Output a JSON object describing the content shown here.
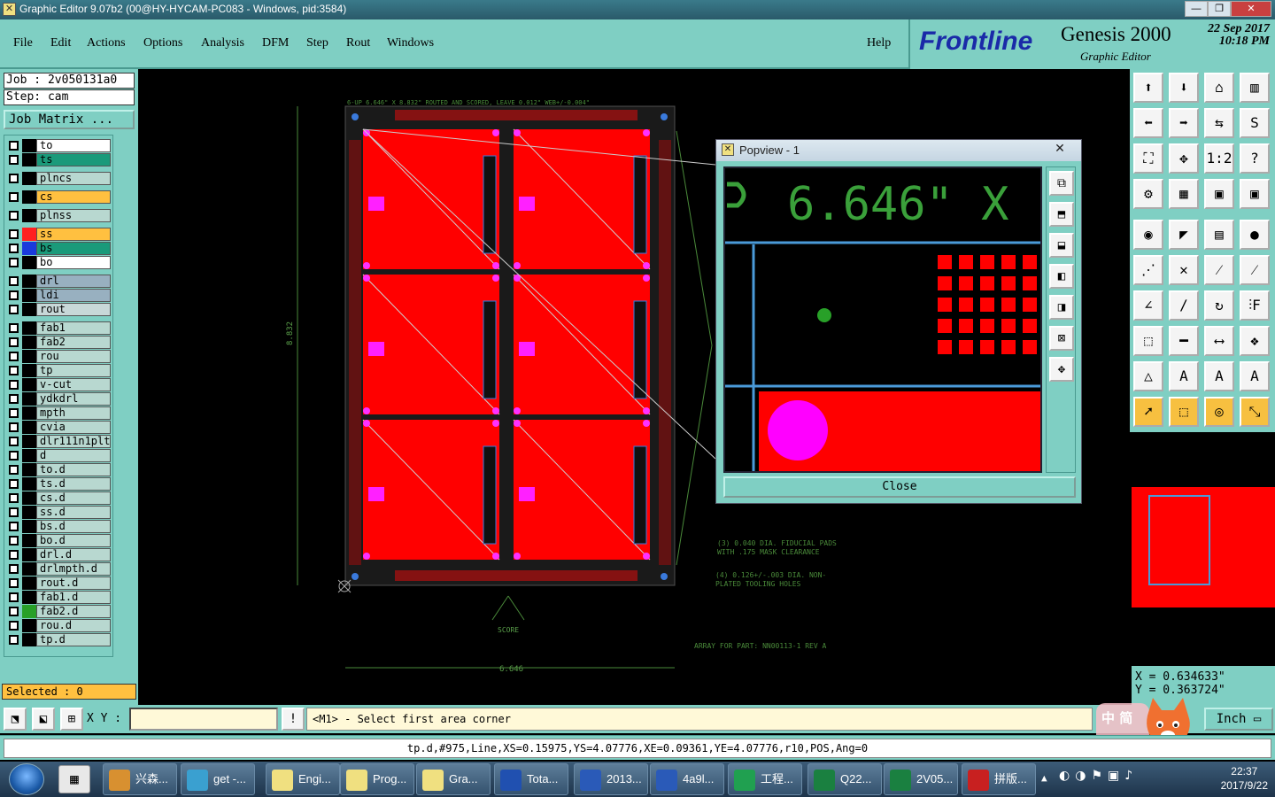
{
  "window": {
    "title": "Graphic Editor 9.07b2 (00@HY-HYCAM-PC083 - Windows, pid:3584)",
    "min_label": "—",
    "max_label": "❐",
    "close_label": "✕"
  },
  "menu": {
    "items": [
      "File",
      "Edit",
      "Actions",
      "Options",
      "Analysis",
      "DFM",
      "Step",
      "Rout",
      "Windows"
    ],
    "help": "Help"
  },
  "brand": {
    "logo": "Frontline",
    "product": "Genesis 2000",
    "subtitle": "Graphic Editor",
    "date": "22 Sep 2017",
    "time": "10:18 PM"
  },
  "job": {
    "job_line": "Job : 2v050131a0",
    "step_line": "Step: cam",
    "matrix_button": "Job Matrix ..."
  },
  "layers": [
    {
      "name": "to",
      "bg": "#ffffff",
      "swatch": "#000000",
      "gap": false
    },
    {
      "name": "ts",
      "bg": "#1a9a7a",
      "swatch": "#000000",
      "gap": false
    },
    {
      "name": "plncs",
      "bg": "#b8d8d0",
      "swatch": "#000000",
      "gap": true
    },
    {
      "name": "cs",
      "bg": "#ffc040",
      "swatch": "#000000",
      "gap": true
    },
    {
      "name": "plnss",
      "bg": "#b8d8d0",
      "swatch": "#000000",
      "gap": true
    },
    {
      "name": "ss",
      "bg": "#ffc040",
      "swatch": "#ff2020",
      "gap": true
    },
    {
      "name": "bs",
      "bg": "#1a9a7a",
      "swatch": "#1a3adc",
      "gap": false
    },
    {
      "name": "bo",
      "bg": "#ffffff",
      "swatch": "#000000",
      "gap": false
    },
    {
      "name": "drl",
      "bg": "#98b0c0",
      "swatch": "#000000",
      "gap": true
    },
    {
      "name": "ldi",
      "bg": "#98b0c0",
      "swatch": "#000000",
      "gap": false
    },
    {
      "name": "rout",
      "bg": "#c8d8d8",
      "swatch": "#000000",
      "gap": false
    },
    {
      "name": "fab1",
      "bg": "#b8d8d0",
      "swatch": "#000000",
      "gap": true
    },
    {
      "name": "fab2",
      "bg": "#b8d8d0",
      "swatch": "#000000",
      "gap": false
    },
    {
      "name": "rou",
      "bg": "#b8d8d0",
      "swatch": "#000000",
      "gap": false
    },
    {
      "name": "tp",
      "bg": "#b8d8d0",
      "swatch": "#000000",
      "gap": false
    },
    {
      "name": "v-cut",
      "bg": "#b8d8d0",
      "swatch": "#000000",
      "gap": false
    },
    {
      "name": "ydkdrl",
      "bg": "#b8d8d0",
      "swatch": "#000000",
      "gap": false
    },
    {
      "name": "mpth",
      "bg": "#b8d8d0",
      "swatch": "#000000",
      "gap": false
    },
    {
      "name": "cvia",
      "bg": "#b8d8d0",
      "swatch": "#000000",
      "gap": false
    },
    {
      "name": "dlr111n1plt",
      "bg": "#b8d8d0",
      "swatch": "#000000",
      "gap": false
    },
    {
      "name": "d",
      "bg": "#b8d8d0",
      "swatch": "#000000",
      "gap": false
    },
    {
      "name": "to.d",
      "bg": "#b8d8d0",
      "swatch": "#000000",
      "gap": false
    },
    {
      "name": "ts.d",
      "bg": "#b8d8d0",
      "swatch": "#000000",
      "gap": false
    },
    {
      "name": "cs.d",
      "bg": "#b8d8d0",
      "swatch": "#000000",
      "gap": false
    },
    {
      "name": "ss.d",
      "bg": "#b8d8d0",
      "swatch": "#000000",
      "gap": false
    },
    {
      "name": "bs.d",
      "bg": "#b8d8d0",
      "swatch": "#000000",
      "gap": false
    },
    {
      "name": "bo.d",
      "bg": "#b8d8d0",
      "swatch": "#000000",
      "gap": false
    },
    {
      "name": "drl.d",
      "bg": "#b8d8d0",
      "swatch": "#000000",
      "gap": false
    },
    {
      "name": "drlmpth.d",
      "bg": "#b8d8d0",
      "swatch": "#000000",
      "gap": false
    },
    {
      "name": "rout.d",
      "bg": "#b8d8d0",
      "swatch": "#000000",
      "gap": false
    },
    {
      "name": "fab1.d",
      "bg": "#b8d8d0",
      "swatch": "#000000",
      "gap": false
    },
    {
      "name": "fab2.d",
      "bg": "#b8d8d0",
      "swatch": "#28a028",
      "gap": false
    },
    {
      "name": "rou.d",
      "bg": "#b8d8d0",
      "swatch": "#000000",
      "gap": false
    },
    {
      "name": "tp.d",
      "bg": "#b8d8d0",
      "swatch": "#000000",
      "gap": false
    }
  ],
  "selected": "Selected : 0",
  "board": {
    "header_note": "6-UP 6.646\" X 8.832\" ROUTED AND SCORED, LEAVE 0.012\" WEB+/-0.004\"",
    "fiducial_note_1": "(3) 0.040 DIA. FIDUCIAL PADS",
    "fiducial_note_2": "WITH .175 MASK CLEARANCE",
    "tooling_note_1": "(4) 0.126+/-.003 DIA. NON-",
    "tooling_note_2": "PLATED TOOLING HOLES",
    "array_note": "ARRAY FOR PART: NN00113-1 REV A",
    "score_label": "SCORE",
    "width_dim": "6.646",
    "height_dim": "8.832"
  },
  "popview": {
    "title": "Popview - 1",
    "zoom_text": "6.646\" X",
    "close_button": "Close"
  },
  "coords": {
    "x_line": "X = 0.634633\"",
    "y_line": "Y = 0.363724\""
  },
  "command": {
    "xy_label": "X Y :",
    "xy_value": "",
    "prompt": "<M1> - Select first area corner",
    "unit": "Inch",
    "status": "tp.d,#975,Line,XS=0.15975,YS=4.07776,XE=0.09361,YE=4.07776,r10,POS,Ang=0"
  },
  "taskbar": {
    "items": [
      {
        "label": "兴森...",
        "icon": "#d89030"
      },
      {
        "label": "get -...",
        "icon": "#3aa0d0"
      },
      {
        "label": "Engi...",
        "icon": "#f0e080"
      },
      {
        "label": "Prog...",
        "icon": "#f0e080"
      },
      {
        "label": "Gra...",
        "icon": "#f0e080"
      },
      {
        "label": "Tota...",
        "icon": "#2050b0"
      },
      {
        "label": "2013...",
        "icon": "#2a5ab8"
      },
      {
        "label": "4a9l...",
        "icon": "#2a5ab8"
      },
      {
        "label": "工程...",
        "icon": "#20a050"
      },
      {
        "label": "Q22...",
        "icon": "#1a8040"
      },
      {
        "label": "2V05...",
        "icon": "#1a8040"
      },
      {
        "label": "拼版...",
        "icon": "#c82020"
      }
    ],
    "time": "22:37",
    "date": "2017/9/22"
  },
  "ime": {
    "chars": "中 简"
  }
}
